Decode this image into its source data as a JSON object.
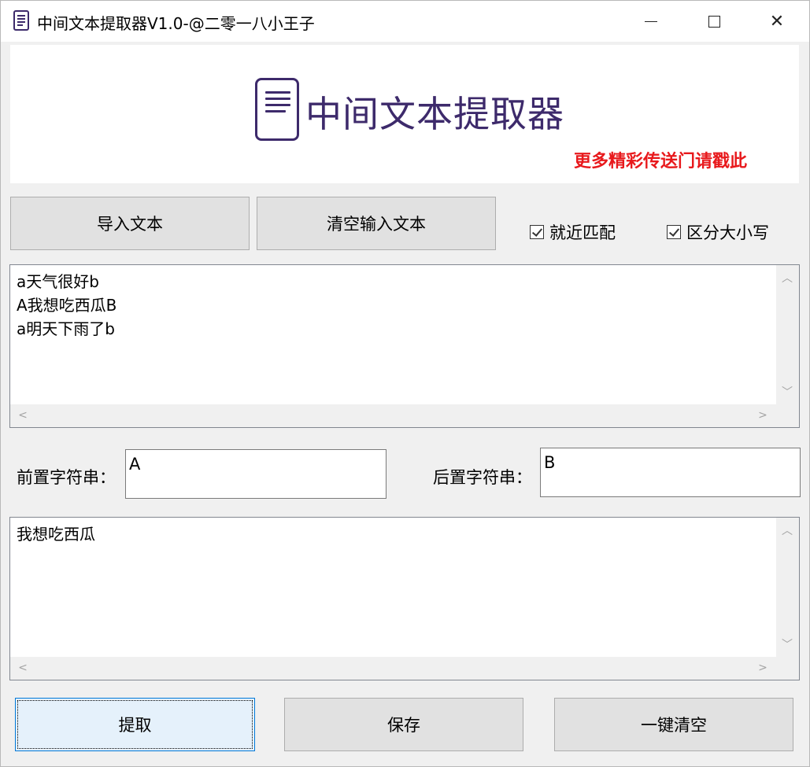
{
  "window": {
    "title": "中间文本提取器V1.0-@二零一八小王子",
    "controls": [
      "minimize",
      "maximize",
      "close"
    ]
  },
  "banner": {
    "logo_text": "中间文本提取器",
    "promo_link": "更多精彩传送门请戳此",
    "accent_color": "#3d2a6b",
    "promo_color": "#e8191c"
  },
  "toolbar": {
    "import_label": "导入文本",
    "clear_input_label": "清空输入文本"
  },
  "options": {
    "nearest_match_label": "就近匹配",
    "nearest_match_checked": true,
    "case_sensitive_label": "区分大小写",
    "case_sensitive_checked": true
  },
  "input_text": {
    "lines": [
      "a天气很好b",
      "A我想吃西瓜B",
      "a明天下雨了b"
    ]
  },
  "prefix": {
    "label": "前置字符串：",
    "value": "A"
  },
  "suffix": {
    "label": "后置字符串：",
    "value": "B"
  },
  "output_text": {
    "lines": [
      "我想吃西瓜"
    ]
  },
  "actions": {
    "extract_label": "提取",
    "save_label": "保存",
    "clear_all_label": "一键清空"
  }
}
